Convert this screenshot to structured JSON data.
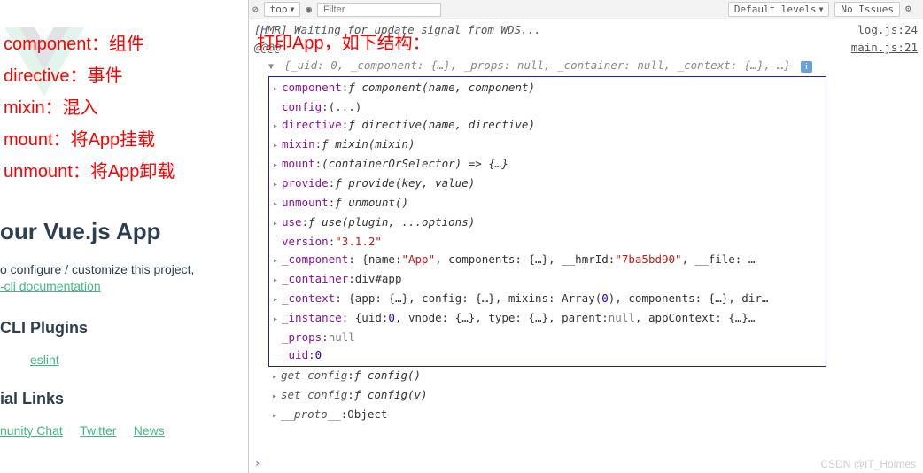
{
  "annotations": {
    "component": "component：组件",
    "directive": "directive：事件",
    "mixin": "mixin：混入",
    "mount": "mount：将App挂载",
    "unmount": "unmount：将App卸载",
    "header_note": "打印App，如下结构："
  },
  "vue_page": {
    "title": "our Vue.js App",
    "subtitle": "o configure / customize this project,",
    "doc_link": "-cli documentation",
    "cli_heading": "CLI Plugins",
    "eslint": "eslint",
    "links_heading": "ial Links",
    "links": [
      "nunity Chat",
      "Twitter",
      "News"
    ]
  },
  "toolbar": {
    "top": "top",
    "filter_placeholder": "Filter",
    "levels": "Default levels",
    "issues": "No Issues"
  },
  "console": {
    "hmr_msg": "[HMR] Waiting for update signal from WDS...",
    "hmr_src": "log.js:24",
    "at_marks": "@@@@",
    "main_src": "main.js:21",
    "summary": "{_uid: 0, _component: {…}, _props: null, _container: null, _context: {…}, …}",
    "props": [
      {
        "tri": "▸",
        "key": "component",
        "val": "ƒ component(name, component)",
        "type": "func"
      },
      {
        "tri": "",
        "key": "config",
        "val": "(...)",
        "type": "obj"
      },
      {
        "tri": "▸",
        "key": "directive",
        "val": "ƒ directive(name, directive)",
        "type": "func"
      },
      {
        "tri": "▸",
        "key": "mixin",
        "val": "ƒ mixin(mixin)",
        "type": "func"
      },
      {
        "tri": "▸",
        "key": "mount",
        "val": "(containerOrSelector) => {…}",
        "type": "func"
      },
      {
        "tri": "▸",
        "key": "provide",
        "val": "ƒ provide(key, value)",
        "type": "func"
      },
      {
        "tri": "▸",
        "key": "unmount",
        "val": "ƒ unmount()",
        "type": "func"
      },
      {
        "tri": "▸",
        "key": "use",
        "val": "ƒ use(plugin, ...options)",
        "type": "func"
      },
      {
        "tri": "",
        "key": "version",
        "val": "\"3.1.2\"",
        "type": "str"
      }
    ],
    "private_props": {
      "component": {
        "name": "\"App\"",
        "hmrId": "\"7ba5bd90\""
      },
      "container": "div#app",
      "uid": "0"
    },
    "below": [
      {
        "tri": "▸",
        "key": "get config",
        "val": "ƒ config()"
      },
      {
        "tri": "▸",
        "key": "set config",
        "val": "ƒ config(v)"
      },
      {
        "tri": "▸",
        "key": "__proto__",
        "val": "Object"
      }
    ]
  },
  "watermark": "CSDN @IT_Holmes"
}
